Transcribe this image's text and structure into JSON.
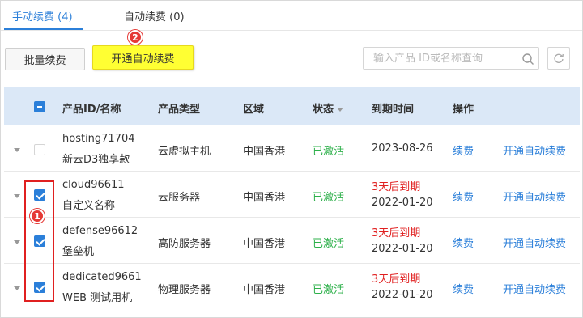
{
  "tabs": [
    {
      "label": "手动续费 (4)",
      "active": true
    },
    {
      "label": "自动续费 (0)",
      "active": false
    }
  ],
  "toolbar": {
    "batch_renew_label": "批量续费",
    "enable_auto_renew_label": "开通自动续费",
    "search_placeholder": "输入产品 ID或名称查询"
  },
  "badges": {
    "step1": "1",
    "step2": "2"
  },
  "table": {
    "headers": {
      "product": "产品ID/名称",
      "type": "产品类型",
      "region": "区域",
      "status": "状态",
      "expiry": "到期时间",
      "ops": "操作"
    },
    "rows": [
      {
        "id": "hosting71704",
        "name": "新云D3独享款",
        "type": "云虚拟主机",
        "region": "中国香港",
        "status": "已激活",
        "warning": "",
        "expiry": "2023-08-26",
        "renew": "续费",
        "auto": "开通自动续费",
        "checked": false
      },
      {
        "id": "cloud96611",
        "name": "自定义名称",
        "type": "云服务器",
        "region": "中国香港",
        "status": "已激活",
        "warning": "3天后到期",
        "expiry": "2022-01-20",
        "renew": "续费",
        "auto": "开通自动续费",
        "checked": true
      },
      {
        "id": "defense96612",
        "name": "堡垒机",
        "type": "高防服务器",
        "region": "中国香港",
        "status": "已激活",
        "warning": "3天后到期",
        "expiry": "2022-01-20",
        "renew": "续费",
        "auto": "开通自动续费",
        "checked": true
      },
      {
        "id": "dedicated9661",
        "name": "WEB 测试用机",
        "type": "物理服务器",
        "region": "中国香港",
        "status": "已激活",
        "warning": "3天后到期",
        "expiry": "2022-01-20",
        "renew": "续费",
        "auto": "开通自动续费",
        "checked": true
      }
    ]
  },
  "colors": {
    "accent": "#2b7fd9",
    "active_status": "#2db04a",
    "warning": "#e02020",
    "highlight": "#ffff33"
  }
}
